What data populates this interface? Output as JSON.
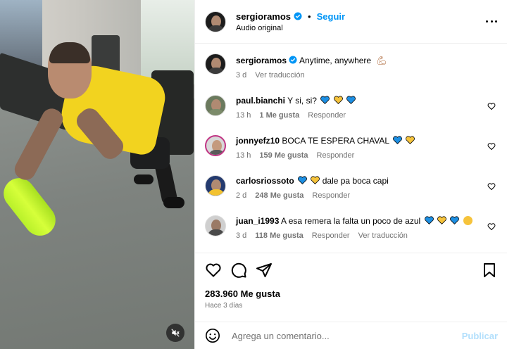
{
  "header": {
    "username": "sergioramos",
    "separator": "•",
    "follow_label": "Seguir",
    "audio": "Audio original"
  },
  "caption": {
    "username": "sergioramos",
    "text": "Anytime, anywhere",
    "age": "3 d",
    "translate": "Ver traducción"
  },
  "comments": [
    {
      "username": "paul.bianchi",
      "text": "Y si, si?",
      "age": "13 h",
      "likes": "1 Me gusta",
      "reply": "Responder",
      "translate": ""
    },
    {
      "username": "jonnyefz10",
      "text": "BOCA TE ESPERA CHAVAL",
      "age": "13 h",
      "likes": "159 Me gusta",
      "reply": "Responder",
      "translate": ""
    },
    {
      "username": "carlosriossoto",
      "text": "dale pa boca capi",
      "age": "2 d",
      "likes": "248 Me gusta",
      "reply": "Responder",
      "translate": ""
    },
    {
      "username": "juan_i1993",
      "text": "A esa remera la falta un poco de azul",
      "age": "3 d",
      "likes": "118 Me gusta",
      "reply": "Responder",
      "translate": "Ver traducción"
    }
  ],
  "stats": {
    "likes": "283.960 Me gusta",
    "ago": "Hace 3 días"
  },
  "add_comment": {
    "placeholder": "Agrega un comentario...",
    "publish_label": "Publicar"
  },
  "colors": {
    "accent": "#0095f6",
    "muted": "#737373",
    "publish_disabled": "#b2dffc",
    "blue_heart": "#1d8fe3",
    "yellow_heart": "#f6c33b"
  }
}
